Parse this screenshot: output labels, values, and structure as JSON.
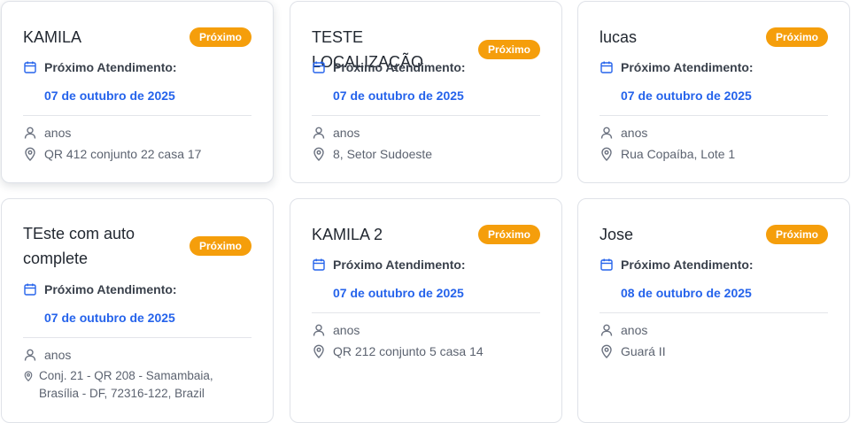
{
  "cards": [
    {
      "name": "KAMILA",
      "badge": "Próximo",
      "appointment_label": "Próximo Atendimento:",
      "appointment_date": "07 de outubro de 2025",
      "age": "anos",
      "address": "QR 412 conjunto 22 casa 17"
    },
    {
      "name": "TESTE LOCALIZAÇÃO",
      "badge": "Próximo",
      "appointment_label": "Próximo Atendimento:",
      "appointment_date": "07 de outubro de 2025",
      "age": "anos",
      "address": "8, Setor Sudoeste"
    },
    {
      "name": "lucas",
      "badge": "Próximo",
      "appointment_label": "Próximo Atendimento:",
      "appointment_date": "07 de outubro de 2025",
      "age": "anos",
      "address": "Rua Copaíba, Lote 1"
    },
    {
      "name": "TEste com auto complete",
      "badge": "Próximo",
      "appointment_label": "Próximo Atendimento:",
      "appointment_date": "07 de outubro de 2025",
      "age": "anos",
      "address_line1": "Conj. 21 - QR 208 - Samambaia,",
      "address_line2": "Brasília - DF, 72316-122, Brazil"
    },
    {
      "name": "KAMILA 2",
      "badge": "Próximo",
      "appointment_label": "Próximo Atendimento:",
      "appointment_date": "07 de outubro de 2025",
      "age": "anos",
      "address": "QR 212 conjunto 5 casa 14"
    },
    {
      "name": "Jose",
      "badge": "Próximo",
      "appointment_label": "Próximo Atendimento:",
      "appointment_date": "08 de outubro de 2025",
      "age": "anos",
      "address": "Guará II"
    }
  ],
  "colors": {
    "badge": "#f59e0b",
    "date": "#2563eb",
    "calendar_icon": "#2563eb",
    "muted_icon": "#6b7280"
  },
  "icons": {
    "calendar": "calendar-icon",
    "person": "user-icon",
    "location": "map-pin-icon"
  }
}
